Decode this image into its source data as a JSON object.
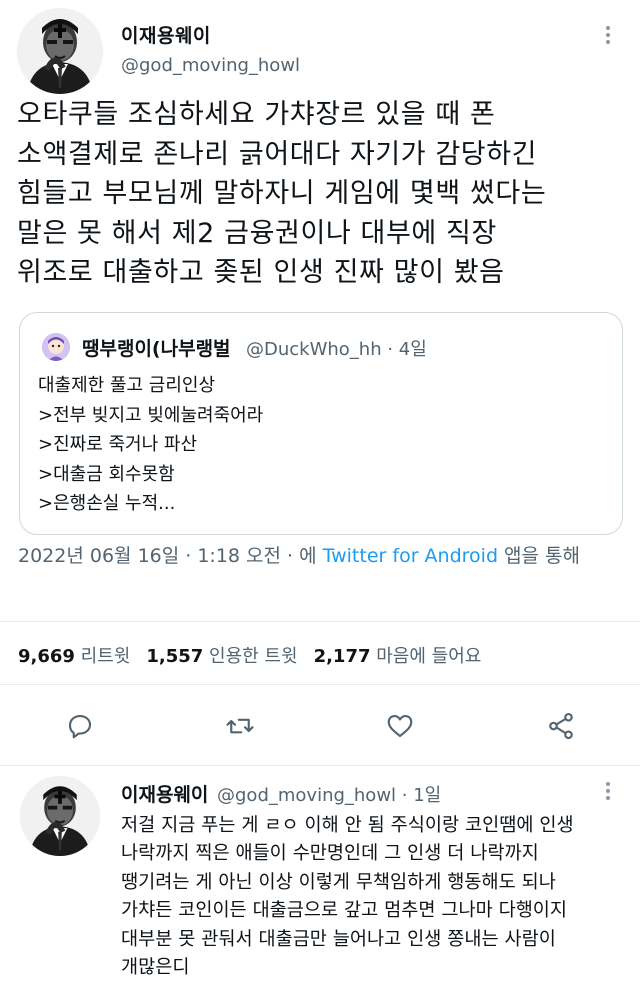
{
  "tweet": {
    "author_name": "이재용웨이",
    "author_handle": "@god_moving_howl",
    "avatar_icon": "profile-photo-icon",
    "text": "오타쿠들 조심하세요 가챠장르 있을 때 폰\n소액결제로 존나리 긁어대다 자기가 감당하긴\n힘들고 부모님께 말하자니 게임에 몇백 썼다는\n말은 못 해서 제2 금융권이나 대부에 직장\n위조로 대출하고 좆된 인생 진짜 많이 봤음",
    "quote": {
      "author_name": "땡부랭이(나부랭벌",
      "author_handle": "@DuckWho_hh · 4일",
      "lines": [
        "대출제한 풀고 금리인상",
        ">전부 빚지고 빚에눌려죽어라",
        ">진짜로 죽거나 파산",
        ">대출금 회수못함",
        ">은행손실 누적..."
      ]
    },
    "meta": {
      "date": "2022년 06월 16일 · 1:18 오전 · 에 ",
      "via": "Twitter for Android",
      "via_suffix": " 앱을 통해"
    },
    "stats": {
      "retweets_count": "9,669",
      "retweets_label": "리트윗",
      "quotes_count": "1,557",
      "quotes_label": "인용한 트윗",
      "likes_count": "2,177",
      "likes_label": "마음에 들어요"
    },
    "actions": [
      "reply-icon",
      "retweet-icon",
      "like-icon",
      "share-icon"
    ]
  },
  "reply": {
    "author_name": "이재용웨이",
    "author_handle": "@god_moving_howl · 1일",
    "text": "저걸 지금 푸는 게 ㄹㅇ 이해 안 됨 주식이랑 코인땜에 인생\n나락까지 찍은 애들이 수만명인데 그 인생 더 나락까지\n땡기려는 게 아닌 이상 이렇게 무책임하게 행동해도 되나\n가챠든 코인이든 대출금으로 갚고 멈추면 그나마 다행이지\n대부분 못 관둬서 대출금만 늘어나고 인생 쫑내는 사람이\n개많은디"
  },
  "colors": {
    "text": "#0f1419",
    "secondary": "#536471",
    "link": "#1d9bf0",
    "border": "#cfd9de"
  }
}
